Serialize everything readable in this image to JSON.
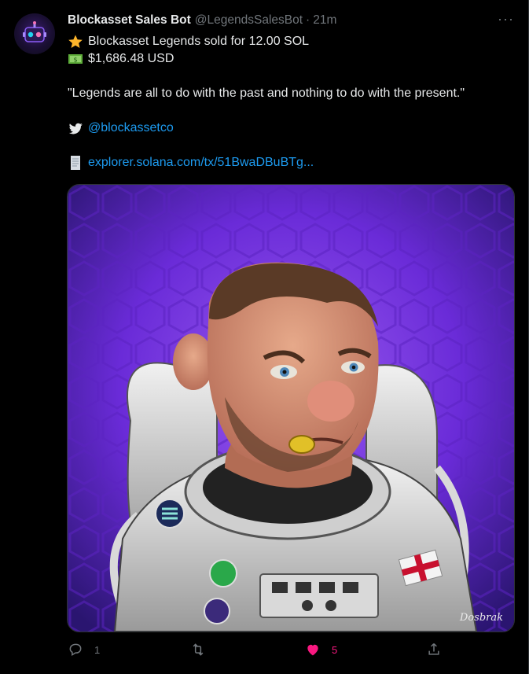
{
  "tweet": {
    "author_name": "Blockasset Sales Bot",
    "author_handle": "@LegendsSalesBot",
    "separator": "·",
    "time": "21m",
    "more": "···",
    "line1": "Blockasset Legends sold for 12.00 SOL",
    "line2": "$1,686.48 USD",
    "quote": "\"Legends are all to do with the past and nothing to do with the present.\"",
    "twitter_link": "@blockassetco",
    "explorer_link": "explorer.solana.com/tx/51BwaDBuBTg...",
    "signature": "Dosbrak"
  },
  "actions": {
    "reply_count": "1",
    "retweet_count": "",
    "like_count": "5"
  },
  "icons": [
    "star-icon",
    "money-icon",
    "twitter-bird-icon",
    "receipt-icon",
    "reply-icon",
    "retweet-icon",
    "heart-icon",
    "share-icon",
    "more-icon"
  ],
  "colors": {
    "background": "#000000",
    "link": "#1d9bf0",
    "muted": "#71767b",
    "like": "#f91880",
    "media_purple": "#6a2bd8"
  }
}
